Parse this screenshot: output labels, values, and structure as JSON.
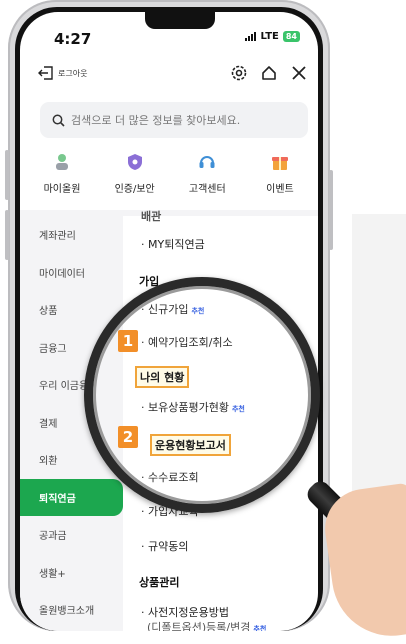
{
  "status": {
    "time": "4:27",
    "network": "LTE",
    "battery": "84"
  },
  "topbar": {
    "logout_label": "로그아웃"
  },
  "search": {
    "placeholder": "검색으로 더 많은 정보를 찾아보세요."
  },
  "quick_menu": [
    {
      "label": "마이올원",
      "icon": "person-icon"
    },
    {
      "label": "인증/보안",
      "icon": "shield-icon"
    },
    {
      "label": "고객센터",
      "icon": "headset-icon"
    },
    {
      "label": "이벤트",
      "icon": "gift-icon"
    }
  ],
  "sidebar": {
    "items": [
      {
        "label": "계좌관리"
      },
      {
        "label": "마이데이터"
      },
      {
        "label": "상품"
      },
      {
        "label": "금융그"
      },
      {
        "label": "우리 이금융"
      },
      {
        "label": "결제"
      },
      {
        "label": "외환"
      },
      {
        "label": "퇴직연금",
        "active": true
      },
      {
        "label": "공과금"
      },
      {
        "label": "생활+"
      },
      {
        "label": "올원뱅크소개"
      }
    ]
  },
  "content": {
    "partial_header": "배관",
    "mypension": "· MY퇴직연금",
    "section_join": "가입",
    "join_new": "· 신규가입",
    "join_new_tag": "추천",
    "join_inquiry": "· 예약가입조회/취소",
    "my_status": "나의 현황",
    "holdings_eval": "· 보유상품평가현황",
    "holdings_tag": "추천",
    "ops_report": "운용현황보고서",
    "fee_inquiry": "· 수수료조회",
    "subscriber_edu": "· 가입자교육",
    "terms": "· 규약동의",
    "section_product": "상품관리",
    "preset_method": "· 사전지정운용방법",
    "preset_sub": "(디폴트옵션)등록/변경",
    "preset_tag": "추천"
  },
  "callouts": {
    "one": "1",
    "two": "2"
  },
  "colors": {
    "accent_green": "#1ca74f",
    "callout_orange": "#f28a1e",
    "tag_blue": "#2e5ae0"
  }
}
